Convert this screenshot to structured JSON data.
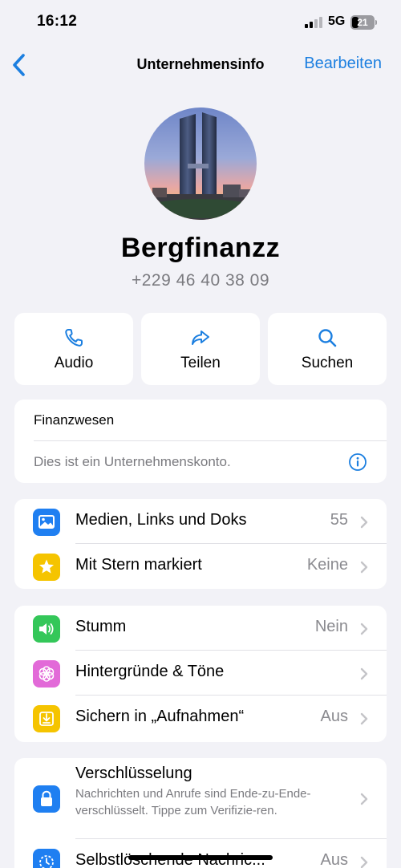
{
  "status_bar": {
    "time": "16:12",
    "network": "5G",
    "battery": "21"
  },
  "nav": {
    "title": "Unternehmensinfo",
    "edit_label": "Bearbeiten"
  },
  "profile": {
    "name": "Bergfinanzz",
    "phone": "+229 46 40 38 09"
  },
  "actions": [
    {
      "label": "Audio",
      "icon": "phone-icon"
    },
    {
      "label": "Teilen",
      "icon": "share-icon"
    },
    {
      "label": "Suchen",
      "icon": "search-icon"
    }
  ],
  "business_info": {
    "category": "Finanzwesen",
    "description": "Dies ist ein Unternehmenskonto."
  },
  "media_section": [
    {
      "label": "Medien, Links und Doks",
      "value": "55",
      "icon": "photo-icon",
      "color": "#1f7ff1"
    },
    {
      "label": "Mit Stern markiert",
      "value": "Keine",
      "icon": "star-icon",
      "color": "#f5c400"
    }
  ],
  "settings_section": [
    {
      "label": "Stumm",
      "value": "Nein",
      "icon": "speaker-icon",
      "color": "#34c759"
    },
    {
      "label": "Hintergründe & Töne",
      "value": "",
      "icon": "flower-icon",
      "color": "#e26ad8"
    },
    {
      "label": "Sichern in „Aufnahmen“",
      "value": "Aus",
      "icon": "save-icon",
      "color": "#f5c400"
    }
  ],
  "encryption": {
    "title": "Verschlüsselung",
    "description": "Nachrichten und Anrufe sind Ende-zu-Ende-verschlüsselt. Tippe zum Verifizie-ren.",
    "icon": "lock-icon",
    "color": "#1f7ff1"
  },
  "disappearing": {
    "label": "Selbstlöschende Nachric...",
    "value": "Aus",
    "icon": "timer-icon",
    "color": "#1f7ff1"
  },
  "colors": {
    "accent": "#1c7fe0",
    "background": "#f2f2f7",
    "secondary_text": "#7a7a7f"
  }
}
